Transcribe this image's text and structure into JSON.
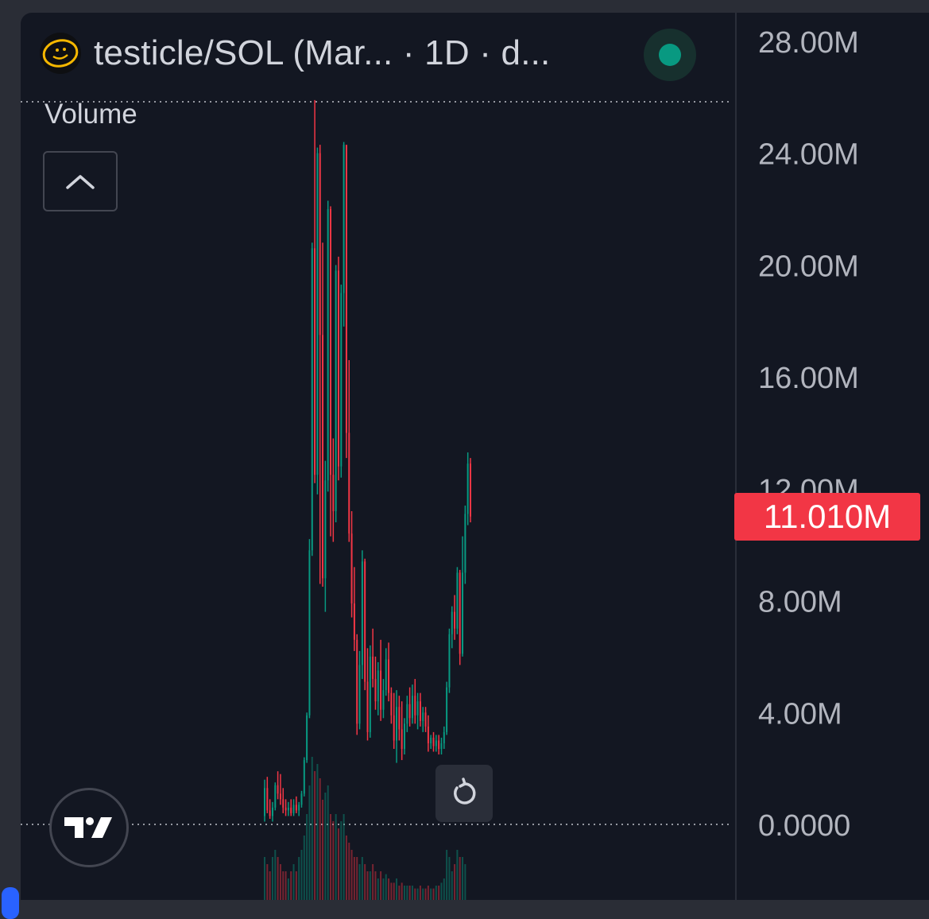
{
  "header": {
    "title": "testicle/SOL (Mar... · 1D · d...",
    "status_color": "#089981"
  },
  "volume_label": "Volume",
  "icons": {
    "logo": "smiley-face-icon",
    "collapse": "chevron-up-icon",
    "reset": "rotate-reset-icon",
    "brand": "tradingview-logo-icon"
  },
  "price_badge": "11.010M",
  "colors": {
    "up": "#089981",
    "down": "#f23645",
    "background": "#131722",
    "text": "#d1d4dc",
    "badge": "#f23645"
  },
  "chart_data": {
    "type": "candlestick",
    "title": "testicle/SOL (Mar... · 1D · d...",
    "y_axis": {
      "ticks": [
        "28.00M",
        "24.00M",
        "20.00M",
        "16.00M",
        "12.00M",
        "8.00M",
        "4.00M",
        "0.0000"
      ],
      "tick_values": [
        28,
        24,
        20,
        16,
        12,
        8,
        4,
        0
      ],
      "unit": "M",
      "ylim": [
        0,
        28
      ]
    },
    "last_value_label": "11.010M",
    "last_value": 11.01,
    "candles": [
      {
        "o": 0.3,
        "h": 1.6,
        "l": 0.1,
        "c": 1.3
      },
      {
        "o": 1.3,
        "h": 1.7,
        "l": 0.4,
        "c": 0.5
      },
      {
        "o": 0.5,
        "h": 0.9,
        "l": 0.2,
        "c": 0.3
      },
      {
        "o": 0.3,
        "h": 0.8,
        "l": 0.1,
        "c": 0.6
      },
      {
        "o": 0.6,
        "h": 1.5,
        "l": 0.5,
        "c": 1.4
      },
      {
        "o": 1.4,
        "h": 1.9,
        "l": 0.9,
        "c": 1.1
      },
      {
        "o": 1.1,
        "h": 1.8,
        "l": 0.7,
        "c": 0.9
      },
      {
        "o": 0.9,
        "h": 1.3,
        "l": 0.4,
        "c": 0.6
      },
      {
        "o": 0.6,
        "h": 0.9,
        "l": 0.3,
        "c": 0.5
      },
      {
        "o": 0.5,
        "h": 0.8,
        "l": 0.3,
        "c": 0.6
      },
      {
        "o": 0.6,
        "h": 0.9,
        "l": 0.3,
        "c": 0.4
      },
      {
        "o": 0.4,
        "h": 0.9,
        "l": 0.3,
        "c": 0.7
      },
      {
        "o": 0.7,
        "h": 1.0,
        "l": 0.4,
        "c": 0.5
      },
      {
        "o": 0.5,
        "h": 0.8,
        "l": 0.3,
        "c": 0.7
      },
      {
        "o": 0.7,
        "h": 1.2,
        "l": 0.6,
        "c": 1.1
      },
      {
        "o": 1.1,
        "h": 2.4,
        "l": 1.0,
        "c": 2.3
      },
      {
        "o": 2.3,
        "h": 4.0,
        "l": 2.2,
        "c": 3.9
      },
      {
        "o": 3.9,
        "h": 10.2,
        "l": 3.8,
        "c": 9.8
      },
      {
        "o": 9.8,
        "h": 20.8,
        "l": 9.6,
        "c": 20.6
      },
      {
        "o": 20.6,
        "h": 25.9,
        "l": 12.2,
        "c": 12.5
      },
      {
        "o": 12.5,
        "h": 24.2,
        "l": 11.8,
        "c": 24.0
      },
      {
        "o": 24.0,
        "h": 24.3,
        "l": 8.6,
        "c": 17.5
      },
      {
        "o": 17.5,
        "h": 20.8,
        "l": 8.5,
        "c": 8.8
      },
      {
        "o": 8.8,
        "h": 13.0,
        "l": 7.6,
        "c": 12.3
      },
      {
        "o": 12.3,
        "h": 22.3,
        "l": 11.9,
        "c": 22.0
      },
      {
        "o": 22.0,
        "h": 22.1,
        "l": 10.3,
        "c": 12.5
      },
      {
        "o": 12.5,
        "h": 13.8,
        "l": 10.1,
        "c": 11.2
      },
      {
        "o": 11.2,
        "h": 20.0,
        "l": 10.8,
        "c": 19.8
      },
      {
        "o": 19.8,
        "h": 20.3,
        "l": 12.3,
        "c": 12.8
      },
      {
        "o": 12.8,
        "h": 19.3,
        "l": 12.4,
        "c": 19.0
      },
      {
        "o": 19.0,
        "h": 24.4,
        "l": 17.8,
        "c": 24.3
      },
      {
        "o": 24.3,
        "h": 19.6,
        "l": 13.1,
        "c": 14.0
      },
      {
        "o": 14.0,
        "h": 16.6,
        "l": 10.1,
        "c": 10.4
      },
      {
        "o": 10.4,
        "h": 11.2,
        "l": 7.4,
        "c": 7.9
      },
      {
        "o": 7.9,
        "h": 9.2,
        "l": 6.2,
        "c": 6.6
      },
      {
        "o": 6.6,
        "h": 6.8,
        "l": 3.2,
        "c": 3.6
      },
      {
        "o": 3.6,
        "h": 6.2,
        "l": 3.4,
        "c": 5.7
      },
      {
        "o": 5.7,
        "h": 9.8,
        "l": 5.2,
        "c": 9.4
      },
      {
        "o": 9.4,
        "h": 9.5,
        "l": 4.8,
        "c": 5.1
      },
      {
        "o": 5.1,
        "h": 6.3,
        "l": 3.0,
        "c": 3.3
      },
      {
        "o": 3.3,
        "h": 6.4,
        "l": 3.1,
        "c": 6.0
      },
      {
        "o": 6.0,
        "h": 7.0,
        "l": 4.9,
        "c": 5.2
      },
      {
        "o": 5.2,
        "h": 6.0,
        "l": 4.1,
        "c": 4.4
      },
      {
        "o": 4.4,
        "h": 5.8,
        "l": 3.9,
        "c": 5.5
      },
      {
        "o": 5.5,
        "h": 6.6,
        "l": 3.7,
        "c": 4.1
      },
      {
        "o": 4.1,
        "h": 5.2,
        "l": 3.8,
        "c": 4.8
      },
      {
        "o": 4.8,
        "h": 6.3,
        "l": 4.6,
        "c": 5.9
      },
      {
        "o": 5.9,
        "h": 6.5,
        "l": 4.4,
        "c": 4.7
      },
      {
        "o": 4.7,
        "h": 4.9,
        "l": 3.6,
        "c": 3.9
      },
      {
        "o": 3.9,
        "h": 4.7,
        "l": 2.7,
        "c": 3.0
      },
      {
        "o": 3.0,
        "h": 4.8,
        "l": 2.2,
        "c": 4.2
      },
      {
        "o": 4.2,
        "h": 4.6,
        "l": 3.0,
        "c": 3.4
      },
      {
        "o": 3.4,
        "h": 4.4,
        "l": 2.3,
        "c": 2.7
      },
      {
        "o": 2.7,
        "h": 3.8,
        "l": 2.5,
        "c": 3.6
      },
      {
        "o": 3.6,
        "h": 4.6,
        "l": 3.3,
        "c": 4.3
      },
      {
        "o": 4.3,
        "h": 4.9,
        "l": 3.5,
        "c": 3.8
      },
      {
        "o": 3.8,
        "h": 5.0,
        "l": 3.6,
        "c": 4.6
      },
      {
        "o": 4.6,
        "h": 5.2,
        "l": 3.6,
        "c": 3.9
      },
      {
        "o": 3.9,
        "h": 4.7,
        "l": 3.4,
        "c": 4.4
      },
      {
        "o": 4.4,
        "h": 4.7,
        "l": 3.5,
        "c": 3.7
      },
      {
        "o": 3.7,
        "h": 4.2,
        "l": 3.3,
        "c": 4.0
      },
      {
        "o": 4.0,
        "h": 4.2,
        "l": 3.3,
        "c": 3.5
      },
      {
        "o": 3.5,
        "h": 3.9,
        "l": 2.6,
        "c": 2.9
      },
      {
        "o": 2.9,
        "h": 3.2,
        "l": 2.7,
        "c": 3.1
      },
      {
        "o": 3.1,
        "h": 3.3,
        "l": 2.6,
        "c": 2.8
      },
      {
        "o": 2.8,
        "h": 3.2,
        "l": 2.6,
        "c": 3.0
      },
      {
        "o": 3.0,
        "h": 3.2,
        "l": 2.5,
        "c": 2.7
      },
      {
        "o": 2.7,
        "h": 3.1,
        "l": 2.5,
        "c": 2.9
      },
      {
        "o": 2.9,
        "h": 3.5,
        "l": 2.7,
        "c": 3.3
      },
      {
        "o": 3.3,
        "h": 5.1,
        "l": 3.2,
        "c": 4.9
      },
      {
        "o": 4.9,
        "h": 7.0,
        "l": 4.7,
        "c": 6.8
      },
      {
        "o": 6.8,
        "h": 7.8,
        "l": 6.3,
        "c": 7.6
      },
      {
        "o": 7.6,
        "h": 8.2,
        "l": 6.6,
        "c": 7.0
      },
      {
        "o": 7.0,
        "h": 9.2,
        "l": 6.8,
        "c": 9.0
      },
      {
        "o": 9.0,
        "h": 9.1,
        "l": 5.7,
        "c": 6.1
      },
      {
        "o": 6.1,
        "h": 10.3,
        "l": 6.0,
        "c": 9.0
      },
      {
        "o": 9.0,
        "h": 11.4,
        "l": 8.6,
        "c": 11.1
      },
      {
        "o": 11.1,
        "h": 13.3,
        "l": 10.7,
        "c": 12.9
      },
      {
        "o": 12.9,
        "h": 13.1,
        "l": 10.8,
        "c": 11.01
      }
    ],
    "volume_heights": [
      0.3,
      0.25,
      0.2,
      0.3,
      0.35,
      0.3,
      0.25,
      0.2,
      0.2,
      0.15,
      0.2,
      0.25,
      0.2,
      0.3,
      0.35,
      0.45,
      0.6,
      0.8,
      1.0,
      0.9,
      0.95,
      0.85,
      0.7,
      0.75,
      0.8,
      0.6,
      0.55,
      0.6,
      0.5,
      0.55,
      0.6,
      0.45,
      0.4,
      0.35,
      0.3,
      0.3,
      0.25,
      0.3,
      0.25,
      0.2,
      0.2,
      0.25,
      0.2,
      0.15,
      0.2,
      0.15,
      0.18,
      0.15,
      0.12,
      0.12,
      0.15,
      0.1,
      0.12,
      0.1,
      0.1,
      0.1,
      0.1,
      0.08,
      0.08,
      0.1,
      0.08,
      0.08,
      0.1,
      0.08,
      0.08,
      0.1,
      0.1,
      0.12,
      0.15,
      0.35,
      0.3,
      0.2,
      0.25,
      0.35,
      0.3,
      0.3,
      0.25
    ],
    "grid": false
  }
}
